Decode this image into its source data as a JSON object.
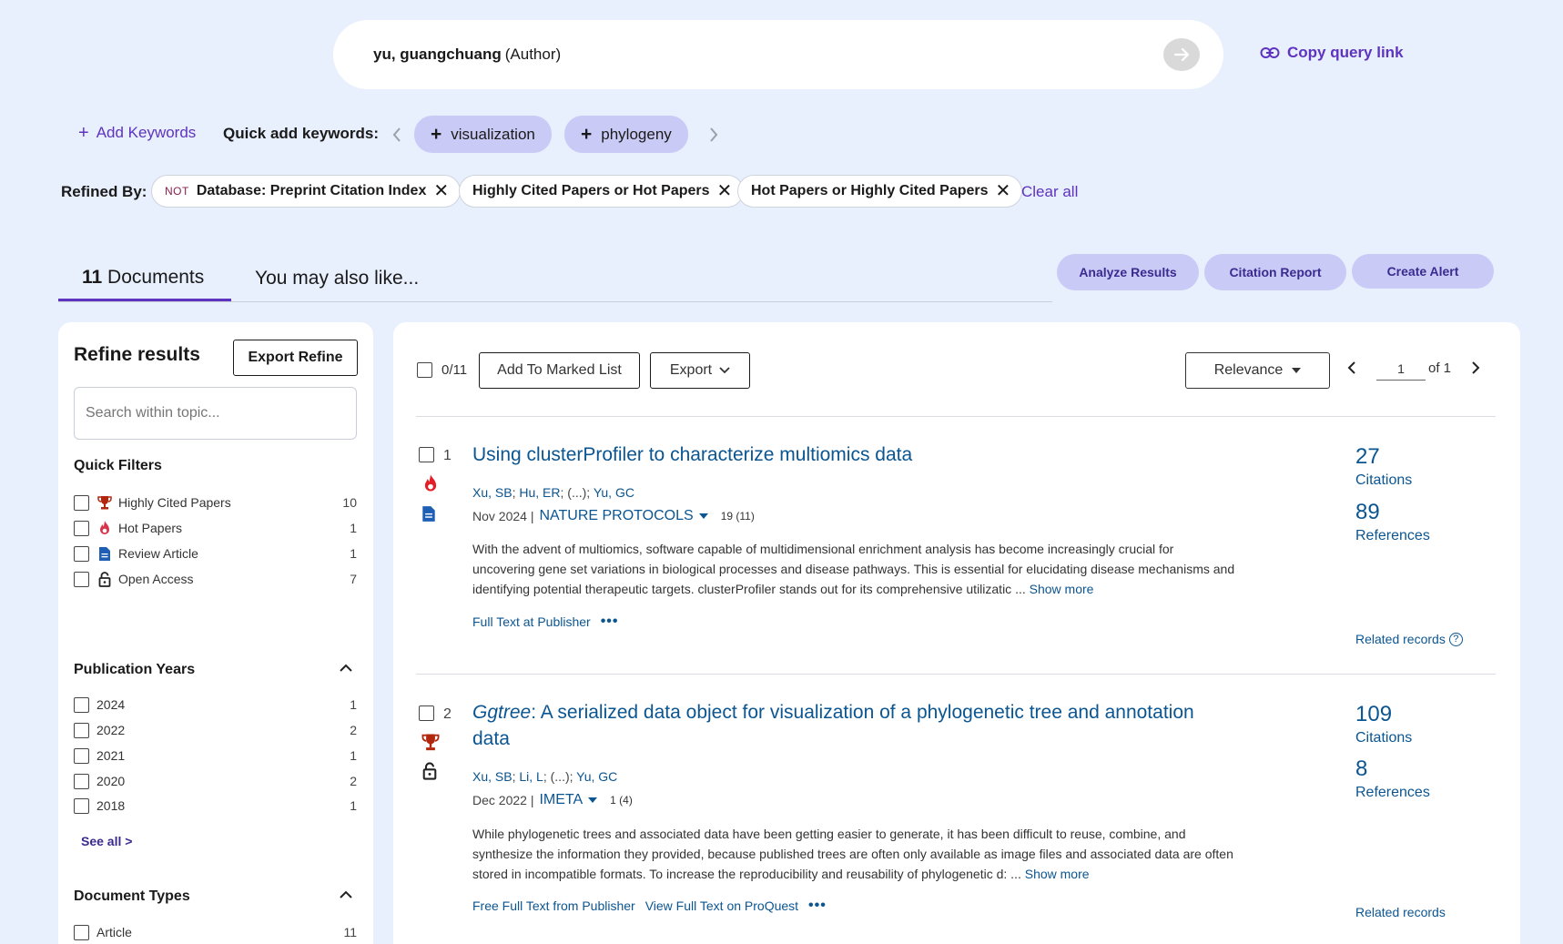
{
  "search": {
    "query_bold": "yu, guangchuang",
    "query_field": "(Author)",
    "copy_link_label": "Copy query link"
  },
  "keywords": {
    "add_label": "Add Keywords",
    "quick_label": "Quick add keywords:",
    "chips": [
      "visualization",
      "phylogeny"
    ]
  },
  "refined": {
    "label": "Refined By:",
    "chips": [
      {
        "prefix": "NOT",
        "text": "Database: Preprint Citation Index"
      },
      {
        "prefix": "",
        "text": "Highly Cited Papers or Hot Papers"
      },
      {
        "prefix": "",
        "text": "Hot Papers or Highly Cited Papers"
      }
    ],
    "clear_all": "Clear all"
  },
  "tabs": {
    "docs_count": "11",
    "docs_label": "Documents",
    "also_like": "You may also like..."
  },
  "actions": {
    "analyze": "Analyze Results",
    "citation_report": "Citation Report",
    "create_alert": "Create Alert"
  },
  "refine": {
    "title": "Refine results",
    "export_label": "Export Refine",
    "search_placeholder": "Search within topic...",
    "quick_filters_title": "Quick Filters",
    "quick_filters": [
      {
        "label": "Highly Cited Papers",
        "count": "10",
        "icon": "trophy-icon"
      },
      {
        "label": "Hot Papers",
        "count": "1",
        "icon": "flame-icon"
      },
      {
        "label": "Review Article",
        "count": "1",
        "icon": "document-icon"
      },
      {
        "label": "Open Access",
        "count": "7",
        "icon": "lock-icon"
      }
    ],
    "years_title": "Publication Years",
    "years": [
      {
        "label": "2024",
        "count": "1"
      },
      {
        "label": "2022",
        "count": "2"
      },
      {
        "label": "2021",
        "count": "1"
      },
      {
        "label": "2020",
        "count": "2"
      },
      {
        "label": "2018",
        "count": "1"
      }
    ],
    "see_all": "See all >",
    "doc_types_title": "Document Types",
    "doc_types": [
      {
        "label": "Article",
        "count": "11"
      }
    ]
  },
  "toolbar": {
    "selected": "0/11",
    "add_marked": "Add To Marked List",
    "export": "Export",
    "sort": "Relevance",
    "page": "1",
    "of_pages": "of 1"
  },
  "records": [
    {
      "num": "1",
      "title_italic": "",
      "title": "Using clusterProfiler to characterize multiomics data",
      "authors": [
        "Xu, SB",
        "Hu, ER",
        "(...)",
        "Yu, GC"
      ],
      "date": "Nov 2024 |",
      "journal": "NATURE PROTOCOLS",
      "vol": "19 (11)",
      "abstract": "With the advent of multiomics, software capable of multidimensional enrichment analysis has become increasingly crucial for uncovering gene set variations in biological processes and disease pathways. This is essential for elucidating disease mechanisms and identifying potential therapeutic targets. clusterProfiler stands out for its comprehensive utilizatic ...",
      "show_more": "Show more",
      "links": [
        "Full Text at Publisher"
      ],
      "citations": "27",
      "citations_label": "Citations",
      "references": "89",
      "references_label": "References",
      "related": "Related records",
      "badges": [
        "flame-icon",
        "document-icon"
      ]
    },
    {
      "num": "2",
      "title_italic": "Ggtree",
      "title": ": A serialized data object for visualization of a phylogenetic tree and annotation data",
      "authors": [
        "Xu, SB",
        "Li, L",
        "(...)",
        "Yu, GC"
      ],
      "date": "Dec 2022 |",
      "journal": "IMETA",
      "vol": "1 (4)",
      "abstract": "While phylogenetic trees and associated data have been getting easier to generate, it has been difficult to reuse, combine, and synthesize the information they provided, because published trees are often only available as image files and associated data are often stored in incompatible formats. To increase the reproducibility and reusability of phylogenetic d: ...",
      "show_more": "Show more",
      "links": [
        "Free Full Text from Publisher",
        "View Full Text on ProQuest"
      ],
      "citations": "109",
      "citations_label": "Citations",
      "references": "8",
      "references_label": "References",
      "related": "Related records",
      "badges": [
        "trophy-icon",
        "lock-icon"
      ]
    }
  ],
  "colors": {
    "background": "#e8effd",
    "accent": "#5e33bf",
    "link": "#0b5591",
    "chip": "#c9cbf6"
  }
}
